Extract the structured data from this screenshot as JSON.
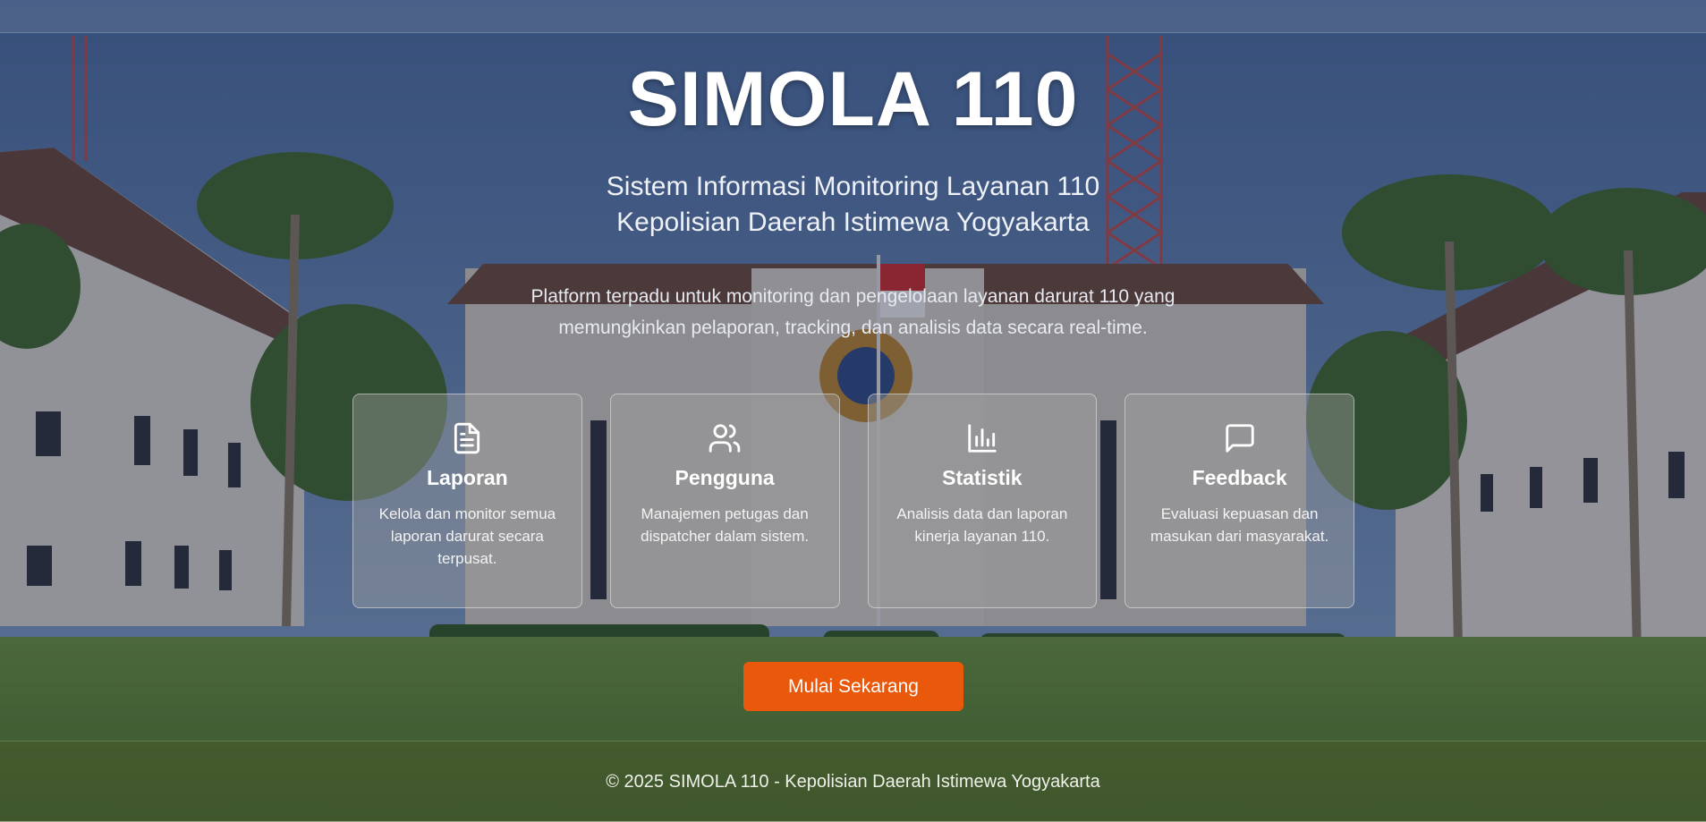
{
  "hero": {
    "title": "SIMOLA 110",
    "subtitle_line1": "Sistem Informasi Monitoring Layanan 110",
    "subtitle_line2": "Kepolisian Daerah Istimewa Yogyakarta",
    "description_line1": "Platform terpadu untuk monitoring dan pengelolaan layanan darurat 110 yang",
    "description_line2": "memungkinkan pelaporan, tracking, dan analisis data secara real-time."
  },
  "features": [
    {
      "icon": "document-icon",
      "title": "Laporan",
      "description": "Kelola dan monitor semua laporan darurat secara terpusat."
    },
    {
      "icon": "users-icon",
      "title": "Pengguna",
      "description": "Manajemen petugas dan dispatcher dalam sistem."
    },
    {
      "icon": "bar-chart-icon",
      "title": "Statistik",
      "description": "Analisis data dan laporan kinerja layanan 110."
    },
    {
      "icon": "chat-bubble-icon",
      "title": "Feedback",
      "description": "Evaluasi kepuasan dan masukan dari masyarakat."
    }
  ],
  "cta": {
    "label": "Mulai Sekarang",
    "color": "#ea580c"
  },
  "footer": {
    "text": "© 2025 SIMOLA 110 - Kepolisian Daerah Istimewa Yogyakarta"
  }
}
